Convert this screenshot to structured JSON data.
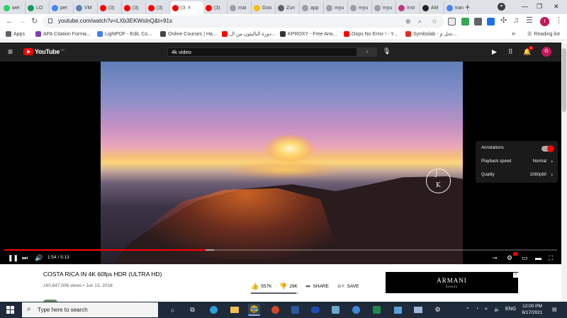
{
  "browser": {
    "tabs": [
      {
        "title": "wel",
        "icon": "whatsapp-icon",
        "color": "#25d366"
      },
      {
        "title": "LO",
        "icon": "google-drive-icon",
        "color": "#0f9d58"
      },
      {
        "title": "per",
        "icon": "google-icon",
        "color": "#4285f4"
      },
      {
        "title": "VM",
        "icon": "gear-icon",
        "color": "#5b7fbf"
      },
      {
        "title": "(3)",
        "icon": "youtube-icon",
        "color": "#ff0000"
      },
      {
        "title": "(3)",
        "icon": "youtube-icon",
        "color": "#ff0000"
      },
      {
        "title": "(3)",
        "icon": "youtube-icon",
        "color": "#ff0000"
      },
      {
        "title": "(3",
        "icon": "youtube-icon",
        "color": "#ff0000",
        "active": true
      },
      {
        "title": "(3)",
        "icon": "youtube-icon",
        "color": "#ff0000"
      },
      {
        "title": "mai",
        "icon": "globe-icon",
        "color": "#9aa0a6"
      },
      {
        "title": "Goo",
        "icon": "google-keep-icon",
        "color": "#fbbc04"
      },
      {
        "title": "Zun",
        "icon": "globe-icon",
        "color": "#5f6368"
      },
      {
        "title": "app",
        "icon": "cloud-icon",
        "color": "#9aa0a6"
      },
      {
        "title": "myu",
        "icon": "globe-icon",
        "color": "#9aa0a6"
      },
      {
        "title": "myu",
        "icon": "globe-icon",
        "color": "#9aa0a6"
      },
      {
        "title": "myu",
        "icon": "globe-icon",
        "color": "#9aa0a6"
      },
      {
        "title": "Inst",
        "icon": "instagram-icon",
        "color": "#c13584"
      },
      {
        "title": "AM",
        "icon": "app-icon",
        "color": "#202124"
      },
      {
        "title": "tran",
        "icon": "google-icon",
        "color": "#4285f4"
      }
    ],
    "url": "youtube.com/watch?v=LXb3EKWsInQ&t=91s",
    "bookmarks": [
      {
        "label": "Apps",
        "color": "#5f6368"
      },
      {
        "label": "APA Citation Forma...",
        "color": "#7b3fb5"
      },
      {
        "label": "LightPDF - Edit, Co...",
        "color": "#3b82f6"
      },
      {
        "label": "Online Courses | Ha...",
        "color": "#444444"
      },
      {
        "label": "دورة الباليئون من ال...",
        "color": "#ff0000"
      },
      {
        "label": "KPROXY - Free Ano...",
        "color": "#333333"
      },
      {
        "label": "Oops No Error ! - Y...",
        "color": "#ff0000"
      },
      {
        "label": "Symbolab - تحل مِ...",
        "color": "#d93025"
      }
    ],
    "reading_list": "Reading list"
  },
  "youtube": {
    "logo_text": "YouTube",
    "country_code": "CR",
    "search_query": "4k video",
    "notification_count": "3",
    "avatar_letter": "G",
    "profile_letter": "I",
    "video": {
      "title": "COSTA RICA IN 4K 60fps HDR (ULTRA HD)",
      "views": "160,647,506 views",
      "date": "Jun 13, 2018",
      "likes": "557K",
      "dislikes": "29K",
      "share_label": "SHARE",
      "save_label": "SAVE",
      "like_ratio": 0.95
    },
    "player": {
      "current_time": "1:54",
      "duration": "5:13",
      "time_display": "1:54 / 5:13",
      "progress": 0.364,
      "buffered": 0.38,
      "watermark_letters": [
        "J",
        "K"
      ],
      "settings_menu": {
        "annotations_label": "Annotations",
        "annotations_on": true,
        "playback_speed_label": "Playback speed",
        "playback_speed_value": "Normal",
        "quality_label": "Quality",
        "quality_value": "1080p60"
      }
    },
    "ad": {
      "brand": "ARMANI",
      "subtitle": "beauty"
    }
  },
  "taskbar": {
    "search_placeholder": "Type here to search",
    "language": "ENG",
    "time": "12:00 PM",
    "date": "6/17/2021"
  },
  "colors": {
    "youtube_red": "#ff0000",
    "yt_dark": "#212121",
    "taskbar": "#1f2a3a"
  }
}
